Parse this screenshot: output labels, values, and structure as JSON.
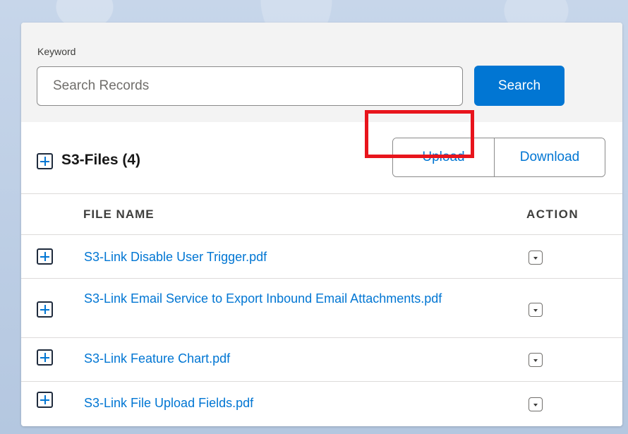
{
  "search": {
    "keyword_label": "Keyword",
    "placeholder": "Search Records",
    "value": "",
    "button_label": "Search"
  },
  "files_section": {
    "title": "S3-Files (4)",
    "upload_label": "Upload",
    "download_label": "Download"
  },
  "table": {
    "columns": [
      "FILE NAME",
      "ACTION"
    ],
    "rows": [
      {
        "file_name": "S3-Link Disable User Trigger.pdf"
      },
      {
        "file_name": "S3-Link Email Service to Export Inbound Email Attachments.pdf"
      },
      {
        "file_name": "S3-Link Feature Chart.pdf"
      },
      {
        "file_name": "S3-Link File Upload Fields.pdf"
      }
    ]
  },
  "colors": {
    "brand_blue": "#0176d3",
    "highlight_red": "#e8141c"
  },
  "icons": {
    "expand": "plus-square-icon",
    "action": "chevron-down-icon"
  }
}
